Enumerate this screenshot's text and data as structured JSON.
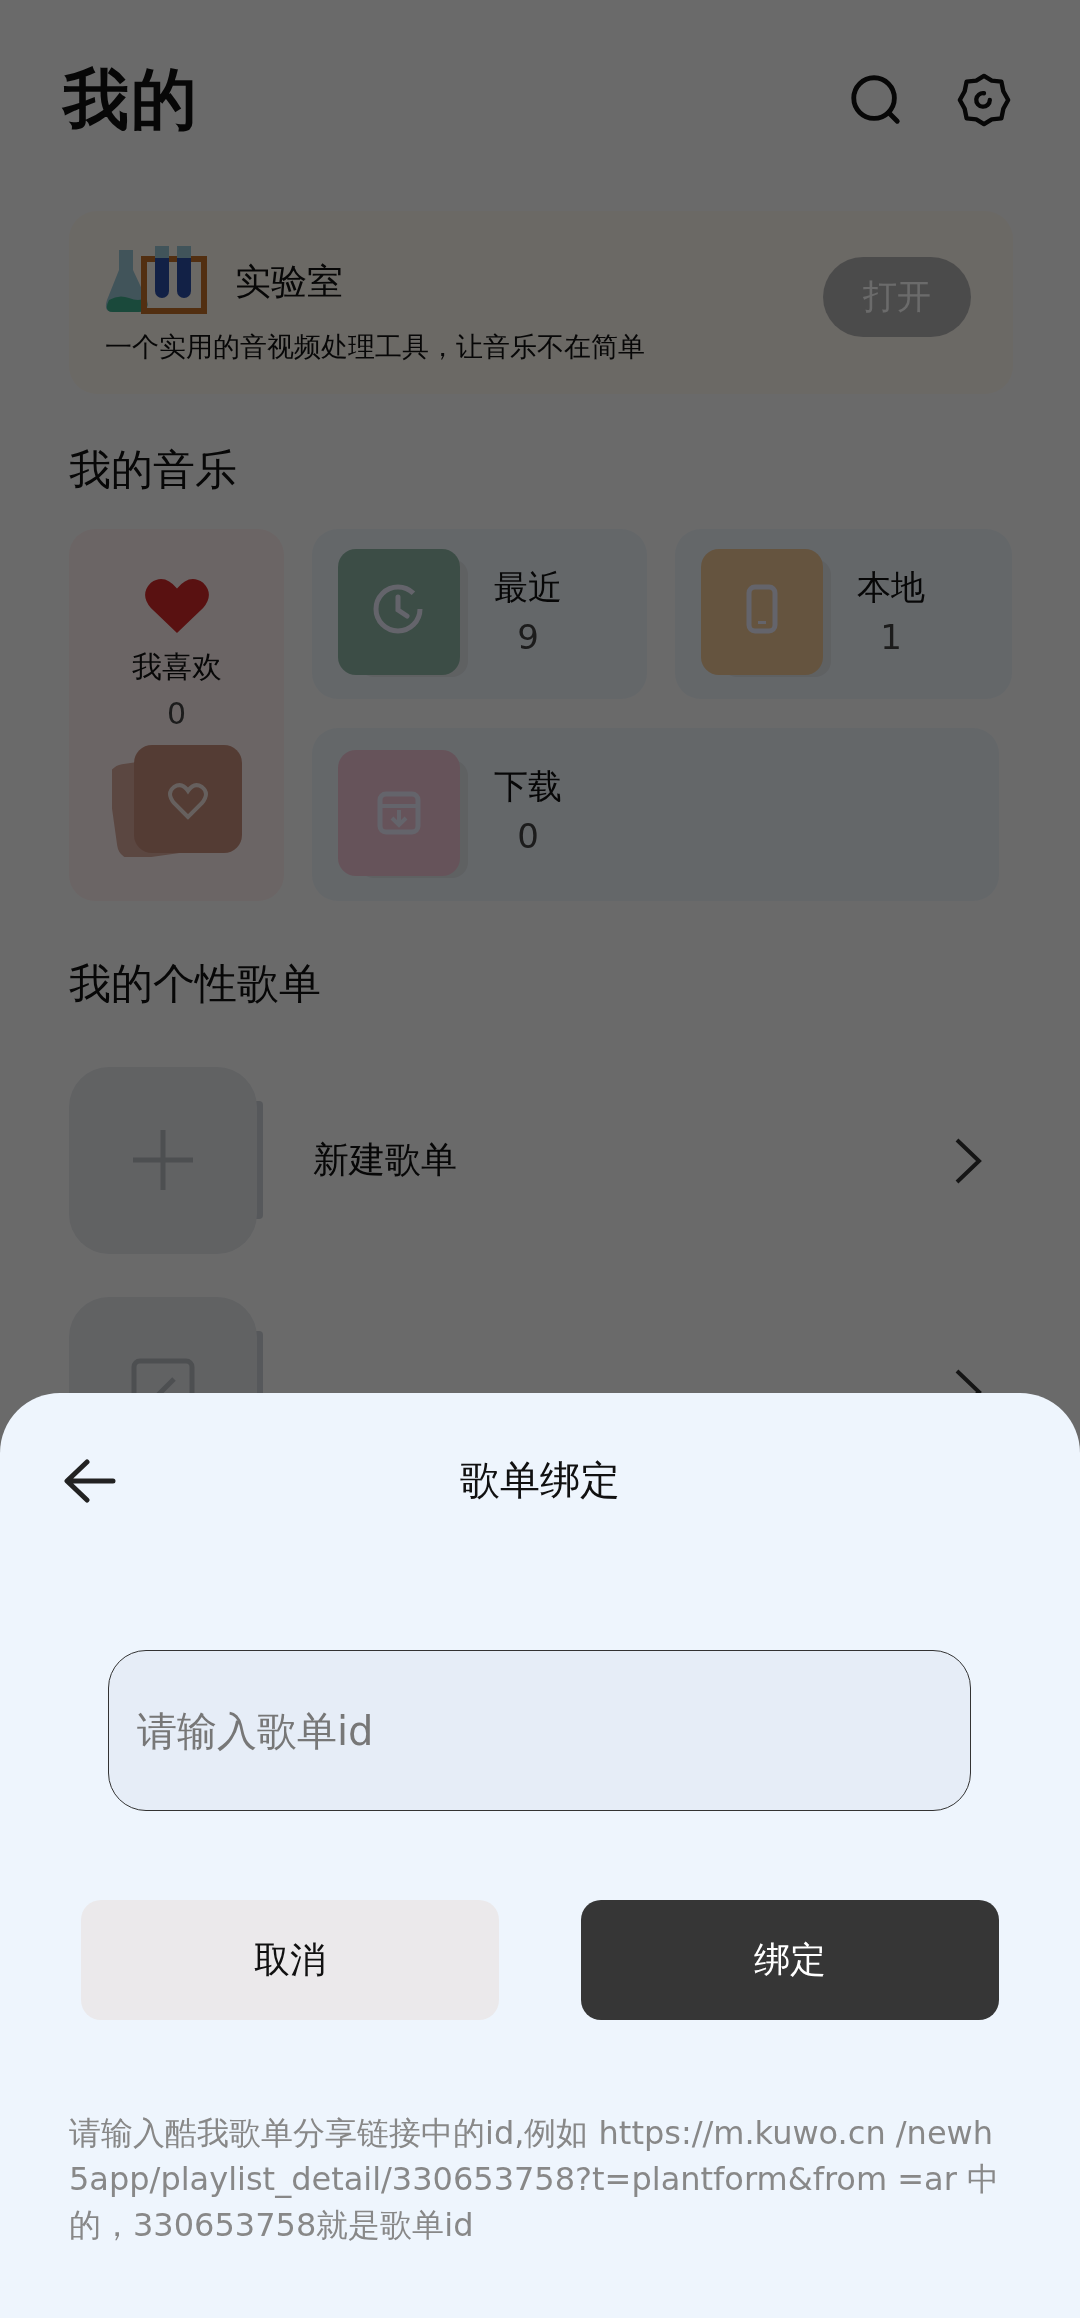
{
  "header": {
    "title": "我的"
  },
  "lab": {
    "title": "实验室",
    "description": "一个实用的音视频处理工具，让音乐不在简单",
    "button": "打开"
  },
  "my_music": {
    "heading": "我的音乐",
    "favorites": {
      "label": "我喜欢",
      "count": "0"
    },
    "tiles": [
      {
        "kind": "recent",
        "label": "最近",
        "count": "9"
      },
      {
        "kind": "local",
        "label": "本地",
        "count": "1"
      },
      {
        "kind": "download",
        "label": "下载",
        "count": "0"
      }
    ]
  },
  "playlists": {
    "heading": "我的个性歌单",
    "items": [
      {
        "kind": "create",
        "label": "新建歌单"
      },
      {
        "kind": "bind"
      }
    ]
  },
  "dialog": {
    "title": "歌单绑定",
    "input": {
      "placeholder": "请输入歌单id"
    },
    "buttons": [
      {
        "kind": "secondary",
        "label": "取消"
      },
      {
        "kind": "primary",
        "label": "绑定"
      }
    ],
    "hint": "请输入酷我歌单分享链接中的id,例如 https://m.kuwo.cn /newh5app/playlist_detail/330653758?t=plantform&from =ar 中的，330653758就是歌单id"
  }
}
